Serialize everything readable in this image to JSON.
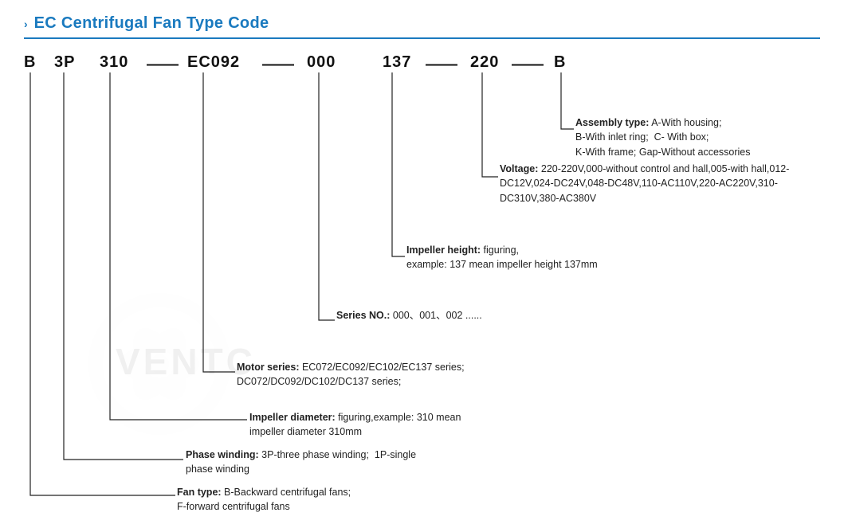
{
  "title": {
    "arrow": "›",
    "text": "EC Centrifugal Fan Type Code"
  },
  "type_code": {
    "chars": [
      "B",
      "3P",
      "310",
      "EC092",
      "000",
      "137",
      "220",
      "B"
    ],
    "dashes": [
      "—",
      "—",
      "—",
      "—",
      "—",
      "—"
    ]
  },
  "annotations": {
    "assembly": {
      "label": "Assembly type:",
      "text": " A-With housing;\nB-With inlet ring;  C- With box;\nK-With frame; Gap-Without accessories"
    },
    "voltage": {
      "label": "Voltage:",
      "text": " 220-220V,000-without control and hall,005-with hall,012-DC12V,024-DC24V,048-DC48V,110-AC110V,220-AC220V,310-DC310V,380-AC380V"
    },
    "impeller_height": {
      "label": "Impeller height:",
      "text": "  figuring,\nexample: 137 mean impeller height 137mm"
    },
    "series_no": {
      "label": "Series NO.:",
      "text": " 000、001、002 ......"
    },
    "motor_series": {
      "label": "Motor series:",
      "text": " EC072/EC092/EC102/EC137 series;\nDC072/DC092/DC102/DC137 series;"
    },
    "impeller_diameter": {
      "label": "Impeller diameter:",
      "text": " figuring,example: 310 mean\nimpeller diameter 310mm"
    },
    "phase_winding": {
      "label": "Phase winding:",
      "text": " 3P-three phase winding;  1P-single\nphase winding"
    },
    "fan_type": {
      "label": "Fan type:",
      "text": " B-Backward centrifugal fans;\nF-forward centrifugal fans"
    }
  },
  "watermark_text": "VENTC",
  "accent_color": "#1a7abf"
}
